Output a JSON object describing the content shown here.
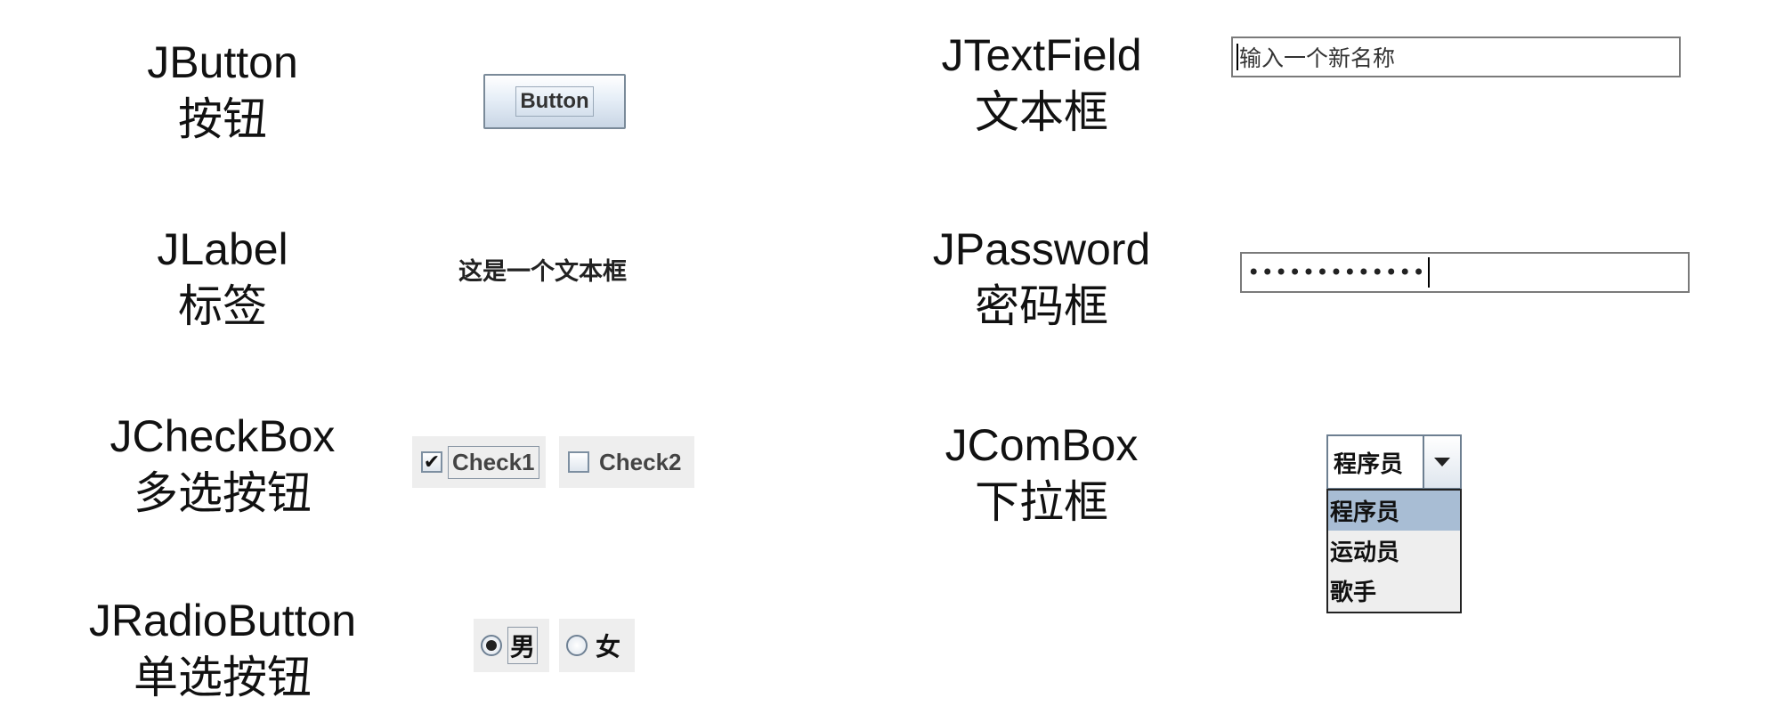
{
  "captions": {
    "jbutton": {
      "en": "JButton",
      "zh": "按钮"
    },
    "jlabel": {
      "en": "JLabel",
      "zh": "标签"
    },
    "jcheckbox": {
      "en": "JCheckBox",
      "zh": "多选按钮"
    },
    "jradiobutton": {
      "en": "JRadioButton",
      "zh": "单选按钮"
    },
    "jtextfield": {
      "en": "JTextField",
      "zh": "文本框"
    },
    "jpassword": {
      "en": "JPassword",
      "zh": "密码框"
    },
    "jcombox": {
      "en": "JComBox",
      "zh": "下拉框"
    }
  },
  "button": {
    "label": "Button"
  },
  "label": {
    "text": "这是一个文本框"
  },
  "checkboxes": [
    {
      "label": "Check1",
      "checked": true,
      "mark": "✔"
    },
    {
      "label": "Check2",
      "checked": false,
      "mark": ""
    }
  ],
  "radios": [
    {
      "label": "男",
      "selected": true
    },
    {
      "label": "女",
      "selected": false
    }
  ],
  "textfield": {
    "value": "输入一个新名称"
  },
  "password": {
    "masked": "•••••••••••••"
  },
  "combo": {
    "selected": "程序员",
    "options": [
      "程序员",
      "运动员",
      "歌手"
    ],
    "highlight_color": "#a8bdd4"
  }
}
